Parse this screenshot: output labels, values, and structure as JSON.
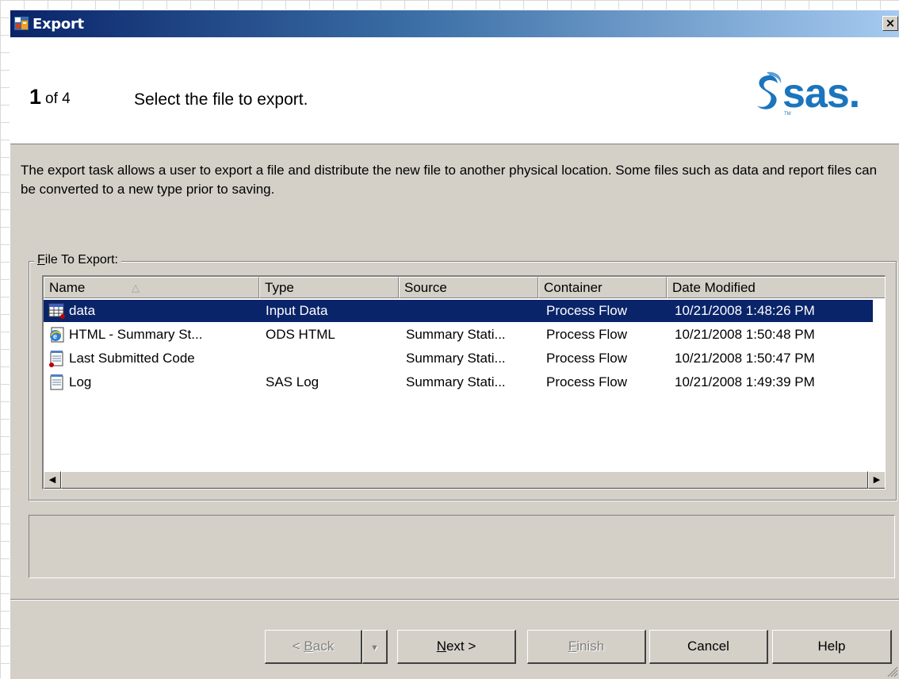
{
  "window": {
    "title": "Export",
    "close_glyph": "×"
  },
  "step": {
    "number": "1",
    "of": "of 4",
    "title": "Select the file to export."
  },
  "logo": {
    "text": "sas.",
    "tm": "TM"
  },
  "description": "The export task allows a user to export a file and distribute the new file to another physical location.  Some files such as data and report files can be converted to a new type prior to saving.",
  "file_group": {
    "legend": "File To Export:"
  },
  "columns": [
    {
      "label": "Name",
      "sorted": "ascending"
    },
    {
      "label": "Type"
    },
    {
      "label": "Source"
    },
    {
      "label": "Container"
    },
    {
      "label": "Date Modified"
    }
  ],
  "rows": [
    {
      "icon": "data-table-icon",
      "name": "data",
      "type": "Input Data",
      "source": "",
      "container": "Process Flow",
      "date": "10/21/2008 1:48:26 PM",
      "selected": true
    },
    {
      "icon": "html-document-icon",
      "name": "HTML - Summary St...",
      "type": "ODS HTML",
      "source": "Summary Stati...",
      "container": "Process Flow",
      "date": "10/21/2008 1:50:48 PM",
      "selected": false
    },
    {
      "icon": "code-notepad-icon",
      "name": "Last Submitted Code",
      "type": "",
      "source": "Summary Stati...",
      "container": "Process Flow",
      "date": "10/21/2008 1:50:47 PM",
      "selected": false
    },
    {
      "icon": "log-notepad-icon",
      "name": "Log",
      "type": "SAS Log",
      "source": "Summary Stati...",
      "container": "Process Flow",
      "date": "10/21/2008 1:49:39 PM",
      "selected": false
    }
  ],
  "buttons": {
    "back": "Back",
    "next": "Next",
    "finish": "Finish",
    "cancel": "Cancel",
    "help": "Help"
  },
  "colors": {
    "selection": "#0a246a",
    "dialog_face": "#d4d0c8",
    "logo_blue": "#1b75bc"
  }
}
